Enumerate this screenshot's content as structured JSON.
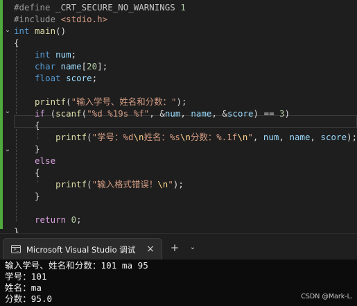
{
  "editor": {
    "lines": [
      [
        {
          "t": "#define ",
          "c": "pp"
        },
        {
          "t": "_CRT_SECURE_NO_WARNINGS",
          "c": "mac"
        },
        {
          "t": " ",
          "c": "pl"
        },
        {
          "t": "1",
          "c": "num"
        }
      ],
      [
        {
          "t": "#include ",
          "c": "pp"
        },
        {
          "t": "<stdio.h>",
          "c": "inc"
        }
      ],
      [
        {
          "t": "int",
          "c": "kw"
        },
        {
          "t": " ",
          "c": "pl"
        },
        {
          "t": "main",
          "c": "fn"
        },
        {
          "t": "()",
          "c": "pl"
        }
      ],
      [
        {
          "t": "{",
          "c": "pl"
        }
      ],
      [
        {
          "t": "    ",
          "c": "pl"
        },
        {
          "t": "int",
          "c": "kw"
        },
        {
          "t": " ",
          "c": "pl"
        },
        {
          "t": "num",
          "c": "var"
        },
        {
          "t": ";",
          "c": "pl"
        }
      ],
      [
        {
          "t": "    ",
          "c": "pl"
        },
        {
          "t": "char",
          "c": "kw"
        },
        {
          "t": " ",
          "c": "pl"
        },
        {
          "t": "name",
          "c": "var"
        },
        {
          "t": "[",
          "c": "pl"
        },
        {
          "t": "20",
          "c": "num"
        },
        {
          "t": "];",
          "c": "pl"
        }
      ],
      [
        {
          "t": "    ",
          "c": "pl"
        },
        {
          "t": "float",
          "c": "kw"
        },
        {
          "t": " ",
          "c": "pl"
        },
        {
          "t": "score",
          "c": "var"
        },
        {
          "t": ";",
          "c": "pl"
        }
      ],
      [],
      [
        {
          "t": "    ",
          "c": "pl"
        },
        {
          "t": "printf",
          "c": "fn"
        },
        {
          "t": "(",
          "c": "pl"
        },
        {
          "t": "\"输入学号、姓名和分数：\"",
          "c": "str"
        },
        {
          "t": ");",
          "c": "pl"
        }
      ],
      [
        {
          "t": "    ",
          "c": "pl"
        },
        {
          "t": "if",
          "c": "kw2"
        },
        {
          "t": " (",
          "c": "pl"
        },
        {
          "t": "scanf",
          "c": "fn"
        },
        {
          "t": "(",
          "c": "pl"
        },
        {
          "t": "\"%d %19s %f\"",
          "c": "str"
        },
        {
          "t": ", &",
          "c": "pl"
        },
        {
          "t": "num",
          "c": "var"
        },
        {
          "t": ", ",
          "c": "pl"
        },
        {
          "t": "name",
          "c": "var"
        },
        {
          "t": ", &",
          "c": "pl"
        },
        {
          "t": "score",
          "c": "var"
        },
        {
          "t": ") == ",
          "c": "pl"
        },
        {
          "t": "3",
          "c": "num"
        },
        {
          "t": ")",
          "c": "pl"
        }
      ],
      [
        {
          "t": "    ",
          "c": "pl"
        },
        {
          "t": "{",
          "c": "pl"
        }
      ],
      [
        {
          "t": "        ",
          "c": "pl"
        },
        {
          "t": "printf",
          "c": "fn"
        },
        {
          "t": "(",
          "c": "pl"
        },
        {
          "t": "\"学号：%d",
          "c": "str"
        },
        {
          "t": "\\n",
          "c": "esc"
        },
        {
          "t": "姓名：%s",
          "c": "str"
        },
        {
          "t": "\\n",
          "c": "esc"
        },
        {
          "t": "分数：%.1f",
          "c": "str"
        },
        {
          "t": "\\n",
          "c": "esc"
        },
        {
          "t": "\"",
          "c": "str"
        },
        {
          "t": ", ",
          "c": "pl"
        },
        {
          "t": "num",
          "c": "var"
        },
        {
          "t": ", ",
          "c": "pl"
        },
        {
          "t": "name",
          "c": "var"
        },
        {
          "t": ", ",
          "c": "pl"
        },
        {
          "t": "score",
          "c": "var"
        },
        {
          "t": ");",
          "c": "pl"
        }
      ],
      [
        {
          "t": "    ",
          "c": "pl"
        },
        {
          "t": "}",
          "c": "pl"
        }
      ],
      [
        {
          "t": "    ",
          "c": "pl"
        },
        {
          "t": "else",
          "c": "kw2"
        }
      ],
      [
        {
          "t": "    ",
          "c": "pl"
        },
        {
          "t": "{",
          "c": "pl"
        }
      ],
      [
        {
          "t": "        ",
          "c": "pl"
        },
        {
          "t": "printf",
          "c": "fn"
        },
        {
          "t": "(",
          "c": "pl"
        },
        {
          "t": "\"输入格式错误！",
          "c": "str"
        },
        {
          "t": "\\n",
          "c": "esc"
        },
        {
          "t": "\"",
          "c": "str"
        },
        {
          "t": ");",
          "c": "pl"
        }
      ],
      [
        {
          "t": "    ",
          "c": "pl"
        },
        {
          "t": "}",
          "c": "pl"
        }
      ],
      [],
      [
        {
          "t": "    ",
          "c": "pl"
        },
        {
          "t": "return",
          "c": "kw2"
        },
        {
          "t": " ",
          "c": "pl"
        },
        {
          "t": "0",
          "c": "num"
        },
        {
          "t": ";",
          "c": "pl"
        }
      ],
      [
        {
          "t": "}",
          "c": "pl"
        }
      ]
    ]
  },
  "terminal": {
    "tab_title": "Microsoft Visual Studio 调试",
    "tab_close_icon": "×",
    "new_tab_icon": "+",
    "dropdown_icon": "⌄",
    "output": [
      "输入学号、姓名和分数：101 ma 95",
      "学号：101",
      "姓名：ma",
      "分数：95.0"
    ],
    "watermark": "CSDN @Mark-L."
  },
  "colors": {
    "editor_bg": "#1e1e1e",
    "terminal_bg": "#0c0c0c",
    "change_bar": "#4fa93d"
  }
}
